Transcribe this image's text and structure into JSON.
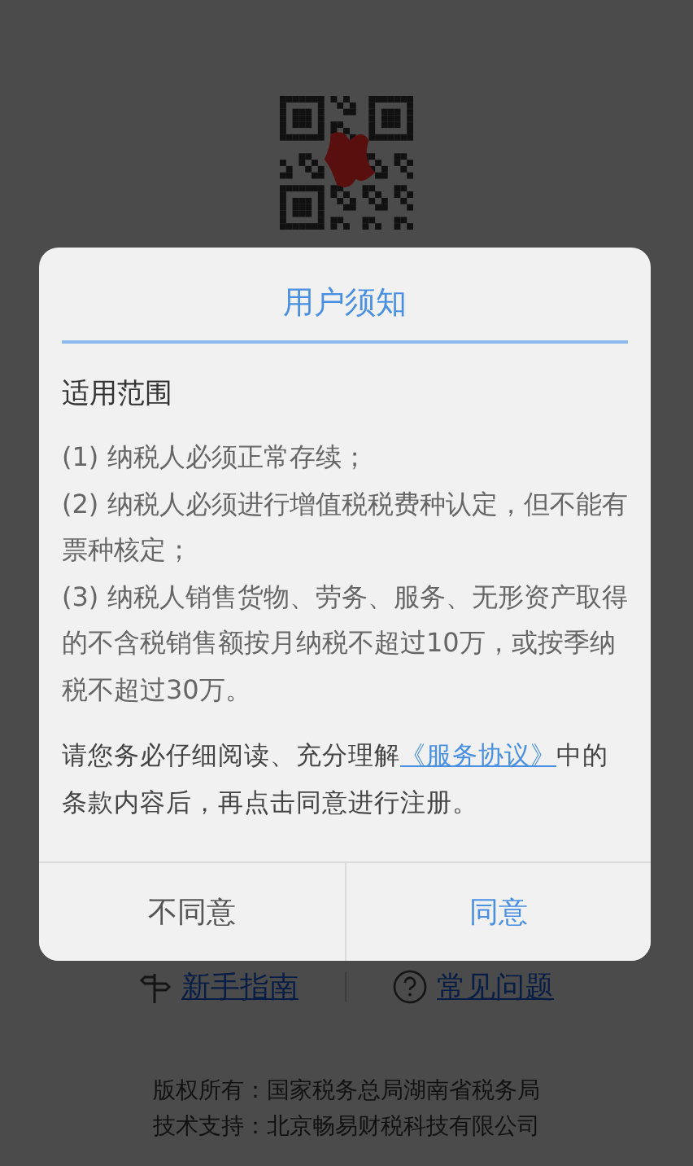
{
  "dialog": {
    "title": "用户须知",
    "section_title": "适用范围",
    "items": [
      "(1) 纳税人必须正常存续；",
      "(2) 纳税人必须进行增值税税费种认定，但不能有票种核定；",
      "(3) 纳税人销售货物、劳务、服务、无形资产取得的不含税销售额按月纳税不超过10万，或按季纳税不超过30万。"
    ],
    "notice": {
      "before": "请您务必仔细阅读、充分理解",
      "link": "《服务协议》",
      "after": "中的条款内容后，再点击同意进行注册。"
    },
    "buttons": [
      {
        "label": "不同意",
        "kind": "cancel"
      },
      {
        "label": "同意",
        "kind": "confirm"
      }
    ]
  },
  "links": [
    {
      "label": "新手指南",
      "kind": "guide"
    },
    {
      "label": "常见问题",
      "kind": "faq"
    }
  ],
  "footer": [
    "版权所有：国家税务总局湖南省税务局",
    "技术支持：北京畅易财税科技有限公司"
  ]
}
